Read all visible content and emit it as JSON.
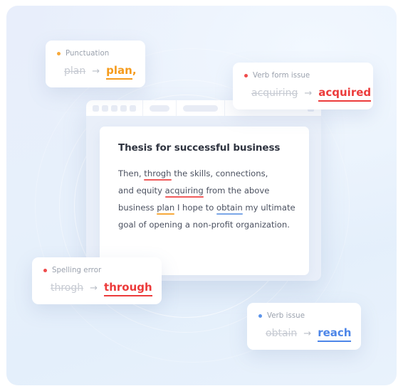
{
  "document": {
    "title": "Thesis for successful business",
    "lines": [
      [
        {
          "text": "Then, ",
          "mark": "none"
        },
        {
          "text": "throgh",
          "mark": "red"
        },
        {
          "text": " the skills, connections,",
          "mark": "none"
        }
      ],
      [
        {
          "text": "and equity ",
          "mark": "none"
        },
        {
          "text": "acquiring",
          "mark": "red"
        },
        {
          "text": " from the above",
          "mark": "none"
        }
      ],
      [
        {
          "text": "business ",
          "mark": "none"
        },
        {
          "text": "plan",
          "mark": "orange"
        },
        {
          "text": " I hope to ",
          "mark": "none"
        },
        {
          "text": "obtain",
          "mark": "blue"
        },
        {
          "text": " my ultimate",
          "mark": "none"
        }
      ],
      [
        {
          "text": "goal of opening a non-profit organization.",
          "mark": "none"
        }
      ]
    ]
  },
  "toolbar": {
    "dots_count": 5,
    "pill_short_label": "",
    "pill_long_label": "",
    "square_label": ""
  },
  "cards": {
    "punctuation": {
      "label": "Punctuation",
      "old": "plan",
      "arrow": "→",
      "new": "plan",
      "suffix": ",",
      "accent": "#f59b1c"
    },
    "verb_form": {
      "label": "Verb form issue",
      "old": "acquiring",
      "arrow": "→",
      "new": "acquired",
      "suffix": "",
      "accent": "#ec3b3b"
    },
    "spelling": {
      "label": "Spelling error",
      "old": "throgh",
      "arrow": "→",
      "new": "through",
      "suffix": "",
      "accent": "#ec3b3b"
    },
    "verb": {
      "label": "Verb issue",
      "old": "obtain",
      "arrow": "→",
      "new": "reach",
      "suffix": "",
      "accent": "#4d86e8"
    }
  },
  "colors": {
    "background_start": "#e8eefb",
    "background_end": "#e9f2fc",
    "accent_orange": "#f59b1c",
    "accent_red": "#ec3b3b",
    "accent_blue": "#4d86e8",
    "underline_red": "#f05b5b",
    "underline_orange": "#f7a93b",
    "underline_blue": "#7ba7e8",
    "doc_title": "#2f3440",
    "doc_body": "#4b5160",
    "card_label": "#9aa1ad",
    "strike_text": "#c7cbd3"
  }
}
